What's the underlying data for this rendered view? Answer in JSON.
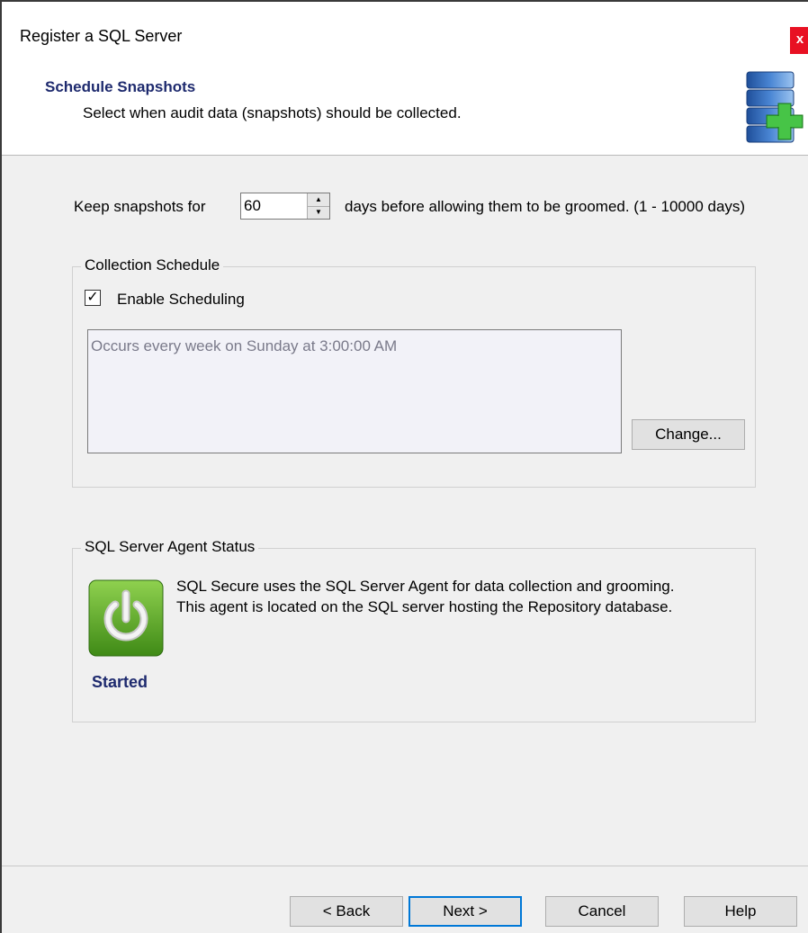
{
  "window": {
    "title": "Register a SQL Server",
    "close_glyph": "x"
  },
  "header": {
    "title": "Schedule Snapshots",
    "subtitle": "Select when audit data (snapshots) should be collected.",
    "icon": "database-add-icon"
  },
  "retention": {
    "label_before": "Keep snapshots for",
    "value": "60",
    "label_after": "days before allowing them to be groomed. (1 - 10000 days)"
  },
  "collection": {
    "group_label": "Collection Schedule",
    "enable_label": "Enable Scheduling",
    "enable_checked": true,
    "schedule_text": "Occurs every week on Sunday at 3:00:00 AM",
    "change_button": "Change..."
  },
  "agent": {
    "group_label": "SQL Server Agent Status",
    "description_line1": "SQL Secure uses the SQL Server Agent for data collection and grooming.",
    "description_line2": "This agent is located on the SQL server hosting the Repository database.",
    "status": "Started",
    "icon": "power-icon"
  },
  "footer": {
    "back": "< Back",
    "next": "Next >",
    "cancel": "Cancel",
    "help": "Help"
  },
  "colors": {
    "accent": "#0078d7",
    "close": "#e81123",
    "heading": "#1e2a6e",
    "status_green": "#5aa524"
  }
}
